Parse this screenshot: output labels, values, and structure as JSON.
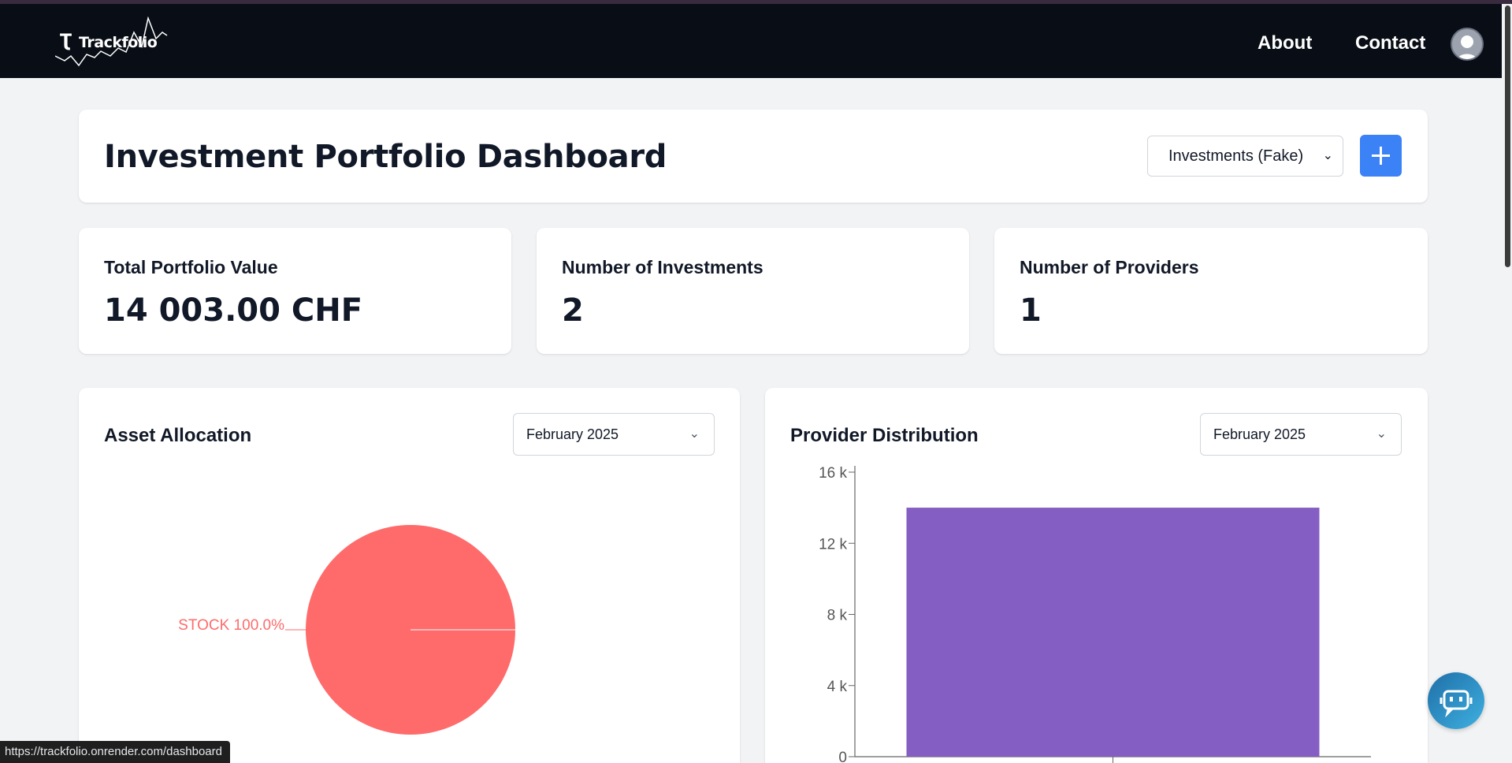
{
  "navbar": {
    "brand": "Trackfolio",
    "links": [
      "About",
      "Contact"
    ]
  },
  "header": {
    "title": "Investment Portfolio Dashboard",
    "portfolio_select": "Investments (Fake)"
  },
  "stats": [
    {
      "label": "Total Portfolio Value",
      "value": "14 003.00 CHF"
    },
    {
      "label": "Number of Investments",
      "value": "2"
    },
    {
      "label": "Number of Providers",
      "value": "1"
    }
  ],
  "asset_allocation": {
    "title": "Asset Allocation",
    "month": "February 2025"
  },
  "provider_distribution": {
    "title": "Provider Distribution",
    "month": "February 2025"
  },
  "status_bar": {
    "url": "https://trackfolio.onrender.com/dashboard"
  },
  "colors": {
    "navbar_bg": "#080d16",
    "accent": "#3b82f6",
    "pie": "#ff6b6b",
    "bar": "#845ec2"
  },
  "icons": {
    "chev": "⌄"
  },
  "chart_data": [
    {
      "type": "pie",
      "slices": [
        {
          "label": "STOCK",
          "value": 100.0,
          "display": "STOCK 100.0%",
          "color": "#ff6b6b"
        }
      ]
    },
    {
      "type": "bar",
      "categories": [
        ""
      ],
      "values": [
        14003
      ],
      "yticks": [
        "0",
        "4 k",
        "8 k",
        "12 k",
        "16 k"
      ],
      "ytick_values": [
        0,
        4000,
        8000,
        12000,
        16000
      ],
      "ylim": [
        0,
        16000
      ],
      "color": "#845ec2"
    }
  ]
}
